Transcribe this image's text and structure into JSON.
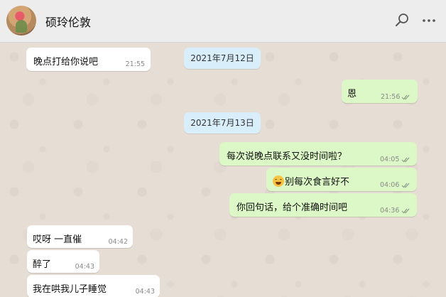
{
  "header": {
    "contact_name": "硕玲伦敦",
    "search_icon": "search-icon",
    "menu_icon": "more-icon"
  },
  "messages": [
    {
      "side": "in",
      "text": "晚点打给你说吧",
      "time": "21:55"
    },
    {
      "type": "date",
      "label": "2021年7月12日"
    },
    {
      "side": "out",
      "text": "恩",
      "time": "21:56"
    },
    {
      "type": "date",
      "label": "2021年7月13日"
    },
    {
      "side": "out",
      "text": "每次说晚点联系又没时间啦？",
      "time": "04:05"
    },
    {
      "side": "out",
      "emoji": "laughing-face",
      "text": "别每次食言好不",
      "time": "04:06"
    },
    {
      "side": "out",
      "text": "你回句话，给个准确时间吧",
      "time": "04:36"
    },
    {
      "side": "in",
      "text": "哎呀 一直催",
      "time": "04:42"
    },
    {
      "side": "in",
      "text": "醉了",
      "time": "04:43"
    },
    {
      "side": "in",
      "text": "我在哄我儿子睡觉",
      "time": "04:43"
    }
  ],
  "colors": {
    "incoming_bubble": "#ffffff",
    "outgoing_bubble": "#dcf8c6",
    "date_badge": "#d9eefb",
    "chat_background": "#e6ddd4",
    "header_background": "#ededed"
  }
}
